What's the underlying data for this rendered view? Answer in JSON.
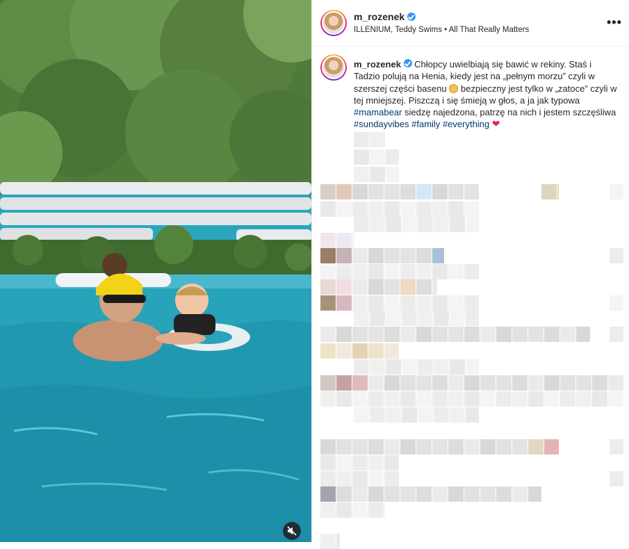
{
  "post": {
    "username": "m_rozenek",
    "audio": "ILLENIUM, Teddy Swims • All That Really Matters",
    "more_label": "•••"
  },
  "caption": {
    "username": "m_rozenek",
    "text_1": "Chłopcy uwielbiają się bawić w rekiny. Staś i Tadzio polują na Henia, kiedy jest na „pełnym morzu” czyli w szerszej części basenu ",
    "text_2": " bezpieczny jest tylko w „zatoce” czyli w tej mniejszej. Piszczą i się śmieją w głos, a ja jak typowa ",
    "tag_1": "#mamabear",
    "text_3": " siedzę najedzona, patrzę na nich i jestem szczęśliwa ",
    "tag_2": "#sundayvibes",
    "tag_3": "#family",
    "tag_4": "#everything",
    "heart": "❤"
  },
  "media": {
    "mute_icon": "speaker-muted-icon"
  },
  "colors": {
    "tag": "#00376b",
    "pool": "#2aa6bd",
    "verified": "#3897f0"
  }
}
